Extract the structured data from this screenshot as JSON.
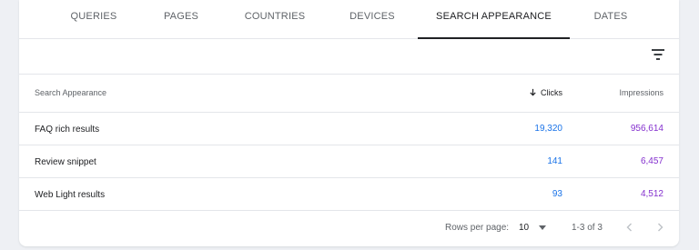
{
  "tabs": [
    {
      "label": "QUERIES"
    },
    {
      "label": "PAGES"
    },
    {
      "label": "COUNTRIES"
    },
    {
      "label": "DEVICES"
    },
    {
      "label": "SEARCH APPEARANCE",
      "active": true
    },
    {
      "label": "DATES"
    }
  ],
  "toolbar": {
    "filter_icon": "filter-list-icon"
  },
  "table": {
    "headers": {
      "dimension": "Search Appearance",
      "clicks": "Clicks",
      "impressions": "Impressions",
      "sort_icon": "arrow-down-icon"
    },
    "rows": [
      {
        "label": "FAQ rich results",
        "clicks": "19,320",
        "impressions": "956,614"
      },
      {
        "label": "Review snippet",
        "clicks": "141",
        "impressions": "6,457"
      },
      {
        "label": "Web Light results",
        "clicks": "93",
        "impressions": "4,512"
      }
    ]
  },
  "pagination": {
    "rows_per_page_label": "Rows per page:",
    "rows_per_page_value": "10",
    "range": "1-3 of 3",
    "prev_icon": "chevron-left-icon",
    "next_icon": "chevron-right-icon"
  },
  "colors": {
    "clicks": "#1a73e8",
    "impressions": "#8430ce",
    "background": "#eef0f4",
    "card": "#ffffff",
    "divider": "#e4e6ea",
    "nav_disabled": "#bdc1c6"
  }
}
